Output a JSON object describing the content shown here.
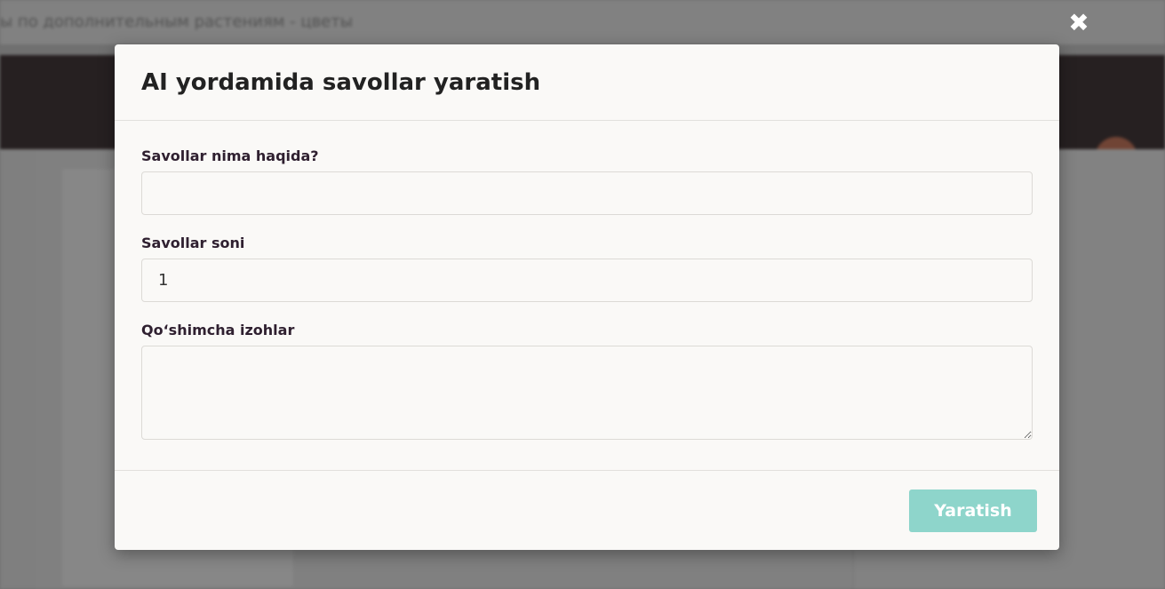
{
  "background": {
    "window_title": "ы по дополнительным растениям - цветы"
  },
  "dialog": {
    "close_icon": "close-icon",
    "title": "AI yordamida savollar yaratish",
    "fields": {
      "topic": {
        "label": "Savollar nima haqida?",
        "value": ""
      },
      "count": {
        "label": "Savollar soni",
        "value": "1"
      },
      "notes": {
        "label": "Qo‘shimcha izohlar",
        "value": ""
      }
    },
    "submit_label": "Yaratish",
    "accent_color": "#8ed5cb"
  }
}
